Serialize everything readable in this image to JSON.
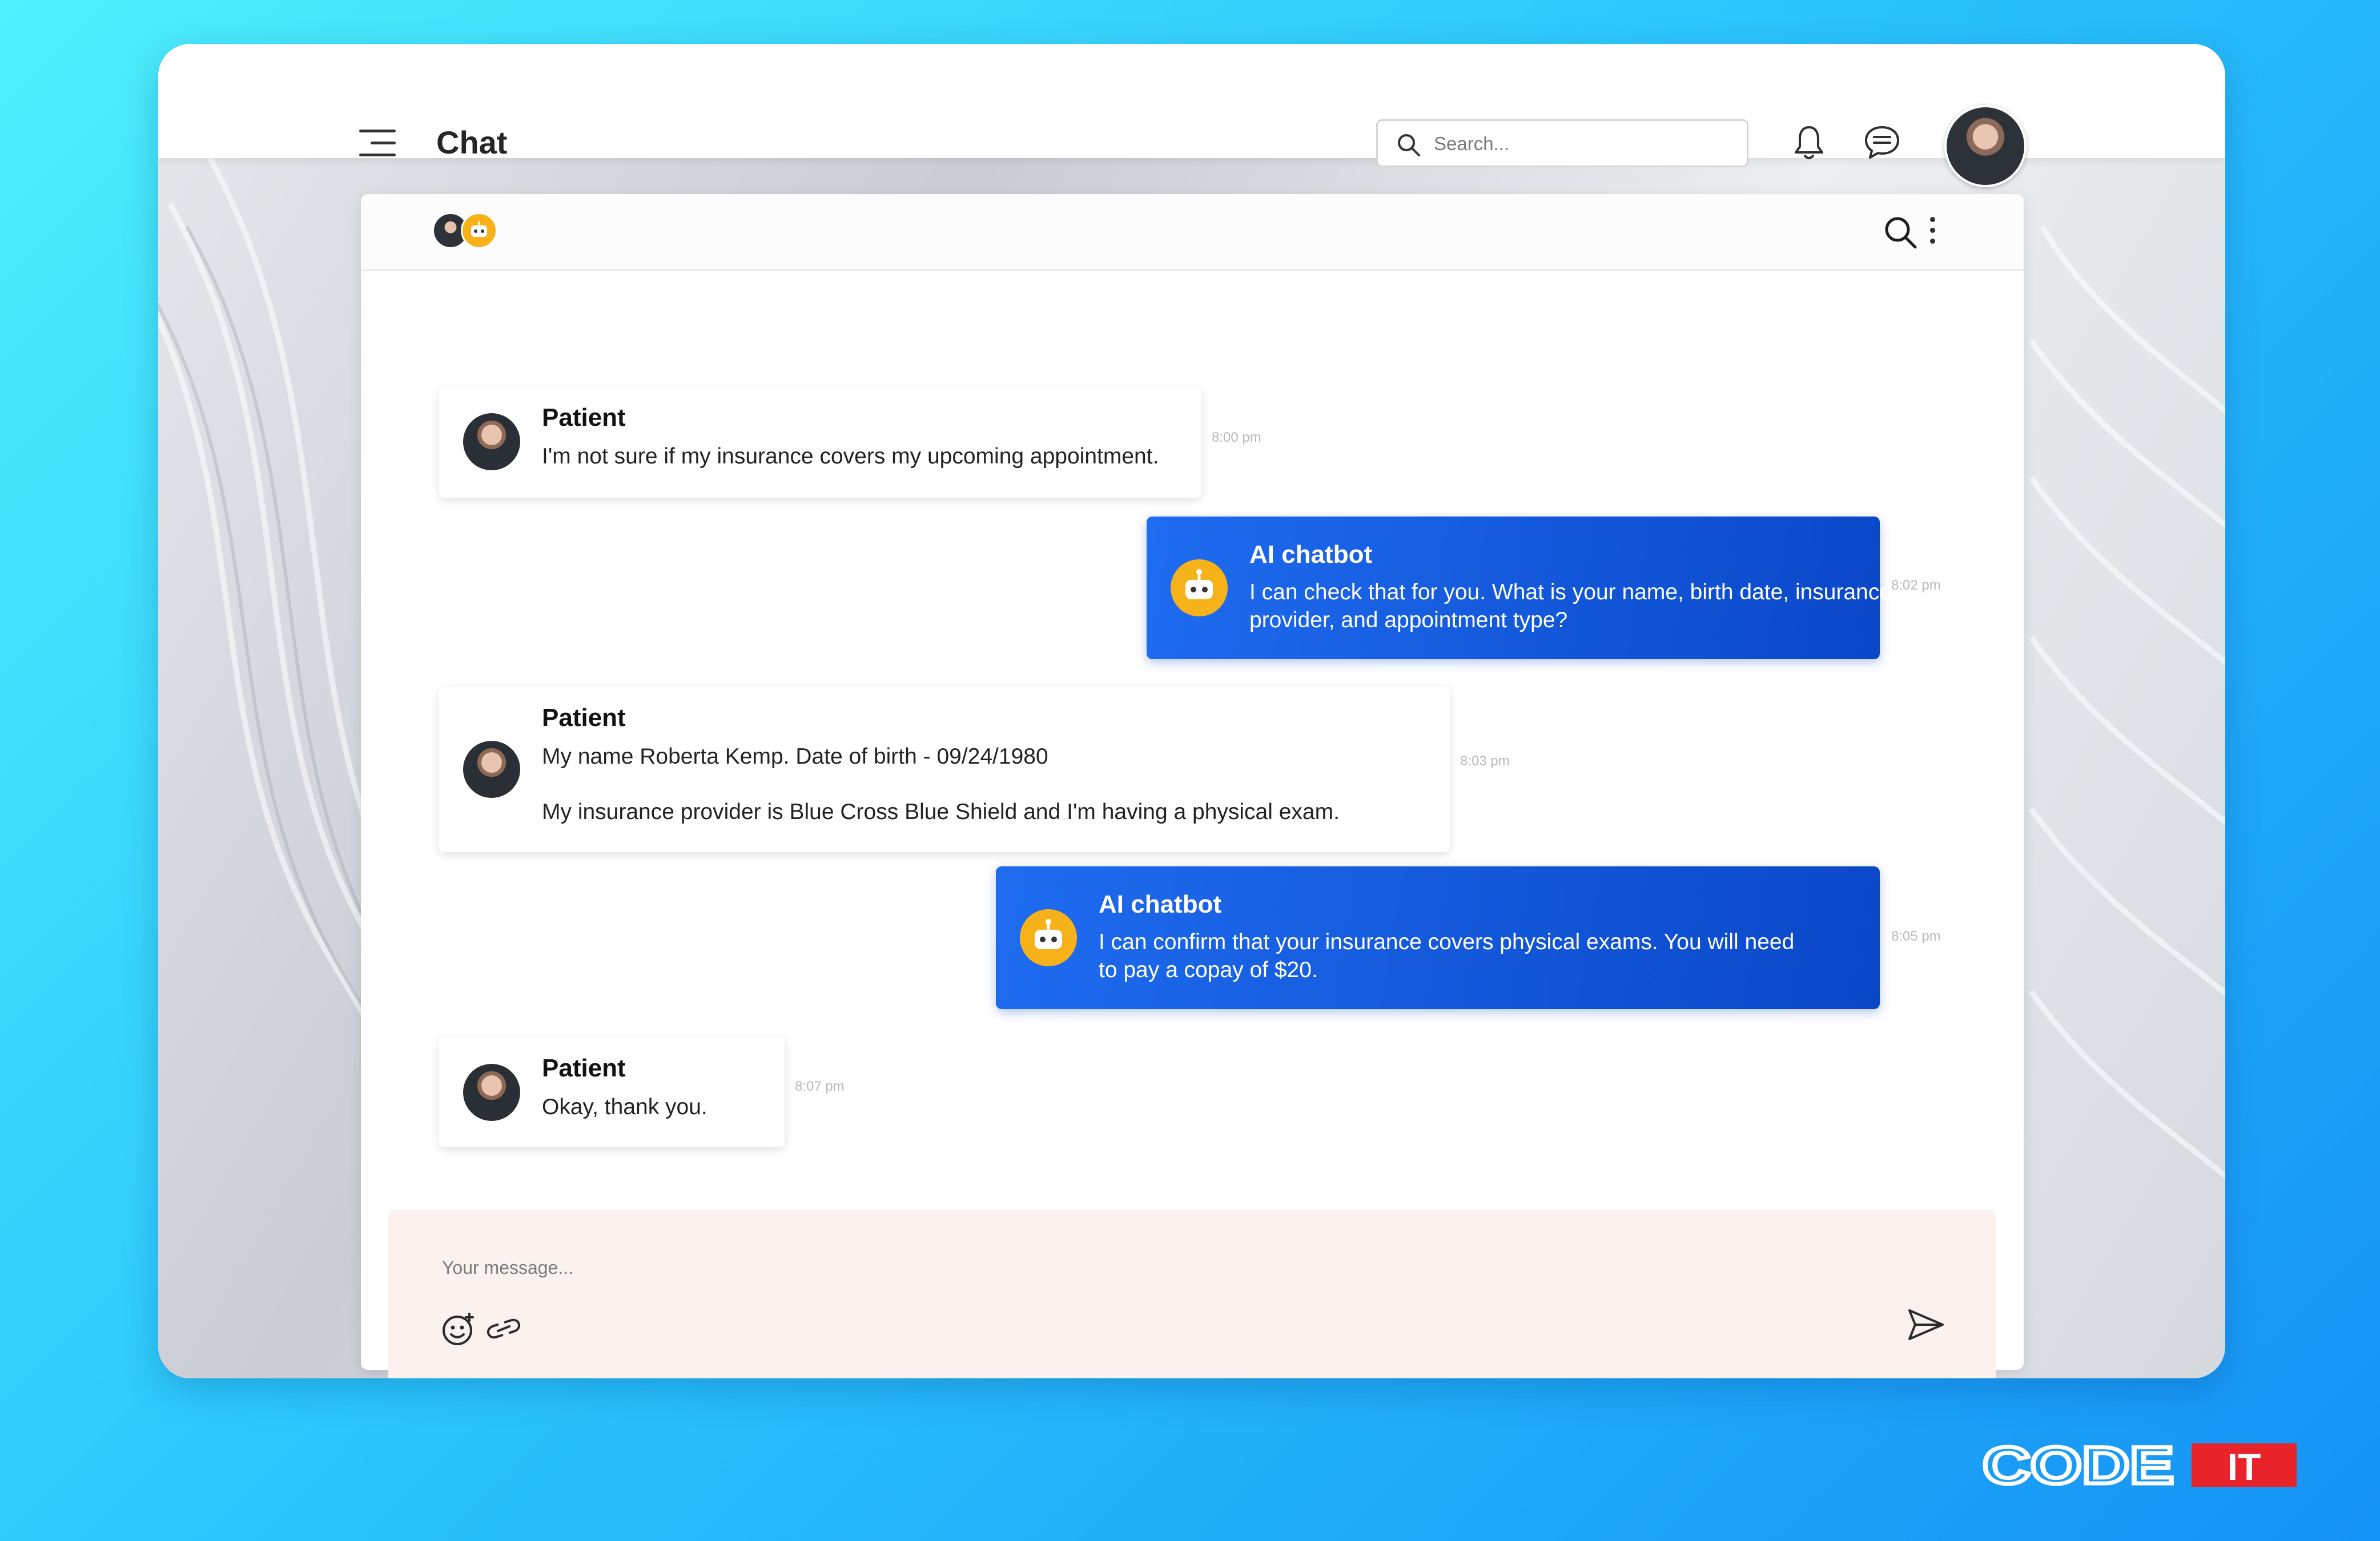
{
  "header": {
    "title": "Chat",
    "search_placeholder": "Search..."
  },
  "conversation": {
    "messages": [
      {
        "sender": "Patient",
        "lines": [
          "I'm not sure if my insurance covers my upcoming appointment."
        ],
        "time": "8:00 pm"
      },
      {
        "sender": "AI chatbot",
        "lines": [
          "I can check that for you. What is your name, birth date, insurance provider, and appointment type?"
        ],
        "time": "8:02 pm"
      },
      {
        "sender": "Patient",
        "lines": [
          "My name Roberta Kemp. Date of birth - 09/24/1980",
          "My insurance provider is Blue Cross Blue Shield and I'm having a physical exam."
        ],
        "time": "8:03 pm"
      },
      {
        "sender": "AI chatbot",
        "lines": [
          "I can confirm that your insurance covers physical exams. You will need to pay a copay of $20."
        ],
        "time": "8:05 pm"
      },
      {
        "sender": "Patient",
        "lines": [
          "Okay, thank you."
        ],
        "time": "8:07 pm"
      }
    ]
  },
  "composer": {
    "placeholder": "Your message..."
  },
  "brand": {
    "part1": "CODE",
    "part2": "IT"
  },
  "icons": {
    "menu": "menu-icon",
    "search": "search-icon",
    "notifications": "bell-icon",
    "messages": "chat-bubble-icon",
    "more": "kebab-icon",
    "emoji": "emoji-icon",
    "attach": "link-icon",
    "send": "send-icon",
    "bot": "robot-icon"
  },
  "colors": {
    "bot_bubble": "#1a5fe0",
    "bot_avatar": "#f7b21a",
    "composer_bg": "#fbf1ef",
    "brand_red": "#e8232a"
  }
}
